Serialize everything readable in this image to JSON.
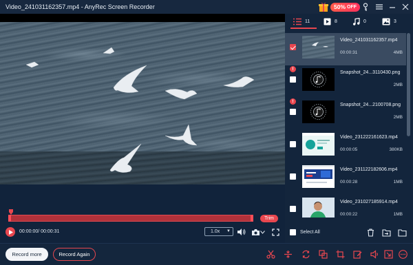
{
  "window": {
    "title": "Video_241031162357.mp4  -  AnyRec Screen Recorder",
    "promo_percent": "50%",
    "promo_off": "OFF"
  },
  "sidebar": {
    "tabs": [
      {
        "icon": "list-icon",
        "count": "11"
      },
      {
        "icon": "video-icon",
        "count": "8"
      },
      {
        "icon": "music-icon",
        "count": "0"
      },
      {
        "icon": "image-icon",
        "count": "3"
      }
    ],
    "items": [
      {
        "name": "Video_241031162357.mp4",
        "duration": "00:00:31",
        "size": "4MB",
        "checked": true,
        "warning": false,
        "thumb": "sea"
      },
      {
        "name": "Snapshot_24...3110430.png",
        "duration": "",
        "size": "2MB",
        "checked": false,
        "warning": true,
        "thumb": "music"
      },
      {
        "name": "Snapshot_24...2100708.png",
        "duration": "",
        "size": "2MB",
        "checked": false,
        "warning": true,
        "thumb": "music"
      },
      {
        "name": "Video_231222161623.mp4",
        "duration": "00:00:05",
        "size": "380KB",
        "checked": false,
        "warning": false,
        "thumb": "web"
      },
      {
        "name": "Video_231122182606.mp4",
        "duration": "00:00:28",
        "size": "1MB",
        "checked": false,
        "warning": false,
        "thumb": "banner"
      },
      {
        "name": "Video_231027185914.mp4",
        "duration": "00:00:22",
        "size": "1MB",
        "checked": false,
        "warning": false,
        "thumb": "person"
      }
    ],
    "select_all_label": "Select All"
  },
  "player": {
    "time": "00:00:00/ 00:00:31",
    "speed": "1.0x",
    "trim_label": "Trim",
    "progress": 0
  },
  "bottom": {
    "record_more": "Record more",
    "record_again": "Record Again"
  },
  "colors": {
    "accent": "#e9474f",
    "background": "#11233b",
    "panel": "#13253c"
  }
}
